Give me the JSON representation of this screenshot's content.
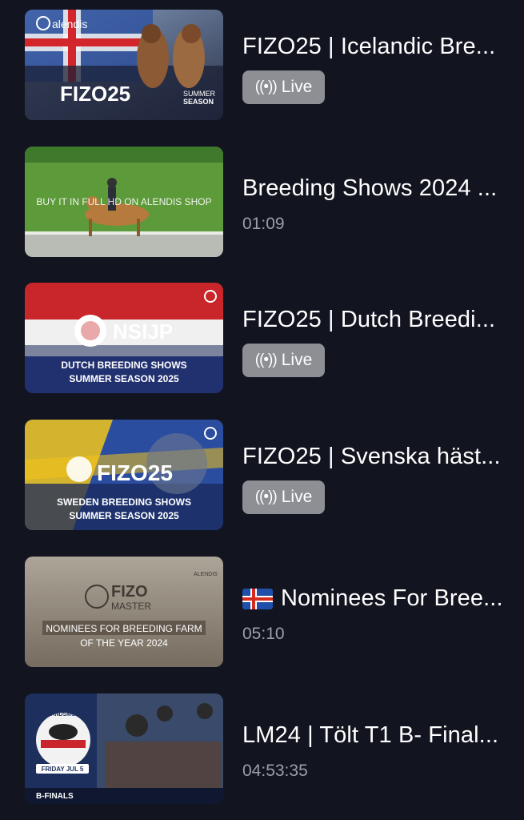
{
  "videos": [
    {
      "title": "FIZO25 | Icelandic Bre...",
      "status": "Live",
      "status_icon": "broadcast-icon",
      "thumb": {
        "brand": "alendis",
        "logo": "FIZO25",
        "sub1": "SUMMER",
        "sub2": "SEASON"
      }
    },
    {
      "title": "Breeding Shows 2024 ...",
      "duration": "01:09",
      "thumb": {
        "caption": "BUY IT IN FULL HD ON ALENDIS SHOP"
      }
    },
    {
      "title": "FIZO25 | Dutch Breedi...",
      "status": "Live",
      "status_icon": "broadcast-icon",
      "thumb": {
        "logo": "NSIJP",
        "line1": "DUTCH BREEDING SHOWS",
        "line2": "SUMMER SEASON 2025"
      }
    },
    {
      "title": "FIZO25 | Svenska häst...",
      "status": "Live",
      "status_icon": "broadcast-icon",
      "thumb": {
        "logo": "FIZO25",
        "line1": "SWEDEN BREEDING SHOWS",
        "line2": "SUMMER SEASON 2025"
      }
    },
    {
      "title": "Nominees For Bree...",
      "flag": "iceland-flag-icon",
      "duration": "05:10",
      "thumb": {
        "logo1": "FIZO",
        "logo2": "MASTER",
        "corner": "ALENDIS",
        "line1": "NOMINEES FOR BREEDING FARM",
        "line2": "OF THE YEAR 2024"
      }
    },
    {
      "title": "LM24 | Tölt T1 B- Final...",
      "duration": "04:53:35",
      "thumb": {
        "badge": "LANDSMOT",
        "date": "FRIDAY JUL 5",
        "label": "B-FINALS"
      }
    }
  ],
  "colors": {
    "background": "#121420",
    "badge": "#8d8f95",
    "duration": "#9c9fa8"
  }
}
